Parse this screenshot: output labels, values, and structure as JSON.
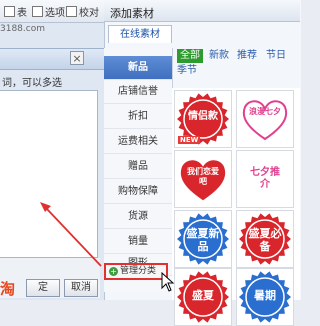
{
  "toolbar": {
    "item1": "表",
    "item2": "选项",
    "item3": "校对"
  },
  "left_dialog": {
    "url_fragment": "3188.com",
    "hint": "词，可以多选",
    "ok_label": "定",
    "cancel_label": "取消",
    "brand_text": "淘",
    "close_glyph": "×"
  },
  "panel": {
    "title": "添加素材",
    "tab_online": "在线素材",
    "categories": [
      {
        "label": "新品",
        "active": true
      },
      {
        "label": "店铺信誉",
        "active": false
      },
      {
        "label": "折扣",
        "active": false
      },
      {
        "label": "运费相关",
        "active": false
      },
      {
        "label": "赠品",
        "active": false
      },
      {
        "label": "购物保障",
        "active": false
      },
      {
        "label": "货源",
        "active": false
      },
      {
        "label": "销量",
        "active": false
      },
      {
        "label": "图形",
        "active": false
      }
    ],
    "manage_label": "管理分类",
    "filters": [
      {
        "label": "全部",
        "selected": true
      },
      {
        "label": "新款",
        "selected": false
      },
      {
        "label": "推荐",
        "selected": false
      },
      {
        "label": "节日",
        "selected": false
      },
      {
        "label": "季节",
        "selected": false
      }
    ],
    "stickers": [
      {
        "text": "情侣款",
        "tag": "NEW"
      },
      {
        "text": "浪漫七夕",
        "tag": ""
      },
      {
        "text": "我们恋爱吧",
        "tag": ""
      },
      {
        "text": "七夕推介",
        "tag": ""
      },
      {
        "text": "盛夏新品",
        "tag": ""
      },
      {
        "text": "盛夏必备",
        "tag": ""
      },
      {
        "text": "盛夏",
        "tag": ""
      },
      {
        "text": "暑期",
        "tag": ""
      }
    ]
  },
  "colors": {
    "accent_red": "#e03030",
    "active_blue": "#4a7cc9",
    "filter_green": "#2d9b2d",
    "sticker_red": "#d8262c",
    "sticker_magenta": "#e0408f",
    "sticker_blue": "#2a6fcf"
  }
}
